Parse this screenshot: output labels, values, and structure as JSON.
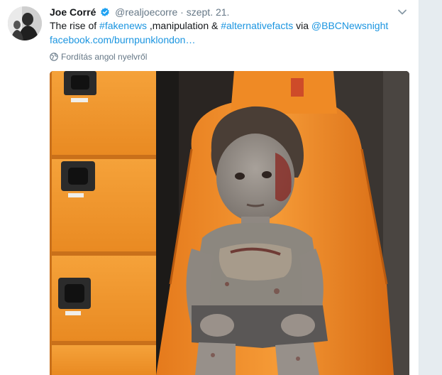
{
  "tweet": {
    "author_name": "Joe Corré",
    "handle": "@realjoecorre",
    "separator": "·",
    "date": "szept. 21.",
    "text_segments": [
      {
        "text": "The rise of ",
        "type": "text"
      },
      {
        "text": "#fakenews",
        "type": "hashtag"
      },
      {
        "text": " ,manipulation & ",
        "type": "text"
      },
      {
        "text": "#alternativefacts",
        "type": "hashtag"
      },
      {
        "text": " via ",
        "type": "text"
      },
      {
        "text": "@BBCNewsnight",
        "type": "mention"
      },
      {
        "text": "facebook.com/burnpunklondon…",
        "type": "url"
      }
    ],
    "translate_label": "Fordítás angol nyelvről"
  },
  "icons": {
    "verified": "verified-badge-icon",
    "caret": "chevron-down-icon",
    "globe": "globe-icon"
  },
  "colors": {
    "link": "#1b95e0",
    "verified": "#1da1f2",
    "text": "#14171a",
    "muted": "#657786",
    "ambulance_orange": "#f28a25"
  }
}
